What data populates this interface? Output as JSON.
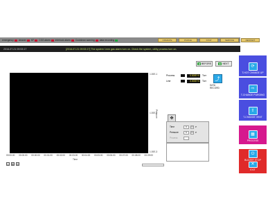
{
  "status_bar": {
    "items": [
      {
        "label": "emergency",
        "led": "red"
      },
      {
        "label": "cleaner",
        "led": "red"
      },
      {
        "label": "KF",
        "led": "red"
      },
      {
        "label": "CO2 alarm",
        "led": "red"
      },
      {
        "label": "interlock alarm",
        "led": "red"
      },
      {
        "label": "Cooldown warning",
        "led": "red"
      },
      {
        "label": "data recording",
        "led": "green"
      }
    ],
    "top_buttons": [
      "OPERATE",
      "PURGE",
      "STOP",
      "SERVICE",
      "RESTART"
    ]
  },
  "info_bar": {
    "datetime": "2016-07-21 09:53:17",
    "message": "[2016-07-21 09:53:17] The system 1mm gas alarm turn on. Check the system, utility process turn on."
  },
  "nav": {
    "before": "BEFORE",
    "next": "NEXT"
  },
  "readouts": [
    {
      "label": "Process",
      "value": "0.000E+0",
      "unit": "Torr"
    },
    {
      "label": "Line",
      "value": "0.000E+0",
      "unit": "Torr"
    }
  ],
  "data_record": {
    "label": "DATA RECORD"
  },
  "plot": {
    "x_ticks": [
      "00:00:00",
      "00:00:00",
      "00:00:00",
      "00:01:00",
      "00:02:00",
      "00:03:00",
      "00:04:00",
      "00:05:00",
      "00:06:00",
      "00:07:00",
      "00:08:00",
      "00:09:00"
    ],
    "x_label": "Time",
    "y_ticks": [
      "1.00E-1",
      "1.00E-2",
      "1.00E-3"
    ],
    "y_label": "Pressure"
  },
  "controls": {
    "rows": [
      {
        "label": "Time",
        "value": "0",
        "unit": "P"
      },
      {
        "label": "Pressure",
        "value": "0",
        "unit": "P"
      },
      {
        "label": "Process",
        "value": "",
        "unit": ""
      }
    ]
  },
  "right_panel": {
    "buttons": [
      {
        "label": "T-HOT CHANGE UP",
        "icon": "refresh-icon",
        "color": "#4a4ee0"
      },
      {
        "label": "T-CHANGE PURGING",
        "icon": "arrow-right-icon",
        "color": "#4a4ee0"
      },
      {
        "label": "T-CHANGE VENT",
        "icon": "arrow-up-icon",
        "color": "#4a4ee0"
      },
      {
        "label": "PROCESS",
        "icon": "calendar-icon",
        "color": "#d6198e"
      },
      {
        "label": "BUZZER STOP",
        "icon": "buzzer-stop-icon",
        "color": "#e02a2a"
      },
      {
        "label": "EXIT",
        "icon": "close-icon",
        "color": "#e02a2a"
      }
    ]
  },
  "colors": {
    "accent": "#4a4ee0",
    "alarm": "#c8102e",
    "ok": "#1aa33a",
    "readout_text": "#ffef3a"
  }
}
